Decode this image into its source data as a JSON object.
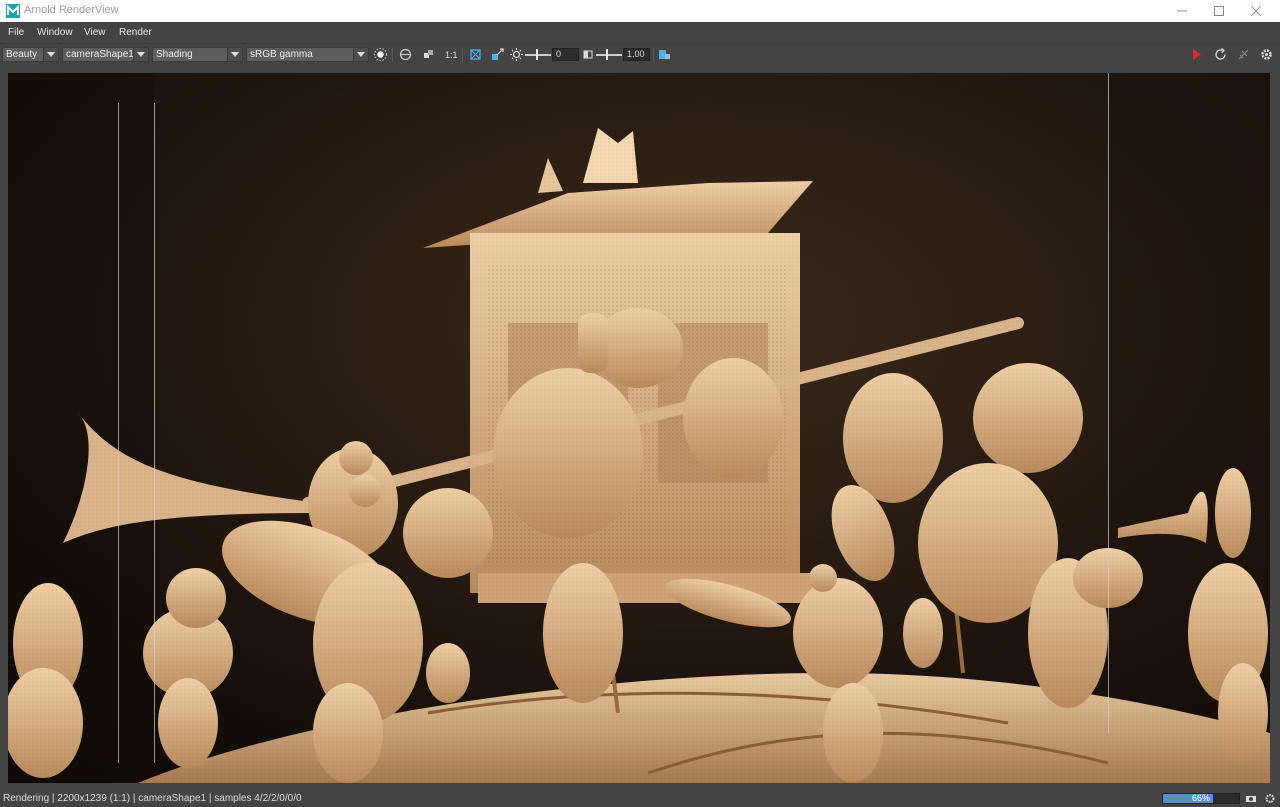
{
  "window": {
    "title": "Arnold RenderView",
    "controls": [
      "minimize-icon",
      "maximize-icon",
      "close-icon"
    ]
  },
  "menu": [
    "File",
    "Window",
    "View",
    "Render"
  ],
  "toolbar": {
    "aov": "Beauty",
    "camera": "cameraShape1",
    "shading": "Shading",
    "color_space": "sRGB gamma",
    "ratio_label": "1:1",
    "exposure_value": "0",
    "gamma_value": "1.00",
    "icons": {
      "light": "sun-icon",
      "compare": "circle-compare-icon",
      "channels": "channels-icon",
      "crop": "crop-icon",
      "debug": "debug-shading-icon",
      "exposure": "exposure-icon",
      "gamma": "gamma-icon",
      "snapshot": "snapshot-icon",
      "render": "render-play-icon",
      "refresh": "refresh-icon",
      "stop": "stop-render-icon",
      "settings": "gear-icon"
    }
  },
  "viewport": {
    "content": "render-image",
    "render_icon_color": "#e02a2a"
  },
  "status": {
    "text": "Rendering | 2200x1239 (1:1) | cameraShape1 | samples 4/2/2/0/0/0",
    "progress": 66,
    "progress_label": "66%"
  },
  "colors": {
    "accent": "#5a8fc0",
    "bg": "#444444"
  }
}
